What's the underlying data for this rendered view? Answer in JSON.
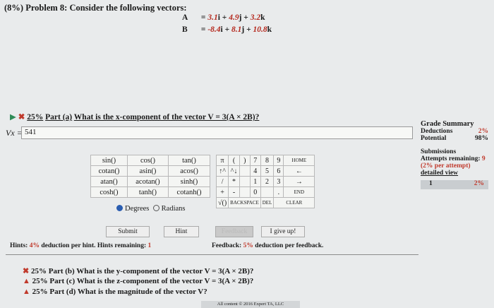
{
  "problem": {
    "title": "(8%) Problem 8: Consider the following vectors:",
    "vectors": [
      {
        "name": "A",
        "eq": "=",
        "c1": "3.1",
        "u1": "i +",
        "c2": "4.9",
        "u2": "j +",
        "c3": "3.2",
        "u3": "k"
      },
      {
        "name": "B",
        "eq": "=",
        "c1": "-8.4",
        "u1": "i +",
        "c2": "8.1",
        "u2": "j +",
        "c3": "10.8",
        "u3": "k"
      }
    ]
  },
  "part_a": {
    "arrow": "▶",
    "mark": "✖",
    "pct": "25%",
    "label": "Part (a)",
    "question": "What is the x-component of the vector V = 3(A × 2B)?",
    "answer_label": "Vx =",
    "answer_value": "541"
  },
  "keypad": {
    "functions": [
      [
        "sin()",
        "cos()",
        "tan()"
      ],
      [
        "cotan()",
        "asin()",
        "acos()"
      ],
      [
        "atan()",
        "acotan()",
        "sinh()"
      ],
      [
        "cosh()",
        "tanh()",
        "cotanh()"
      ]
    ],
    "keys": [
      [
        "π",
        "(",
        ")",
        "7",
        "8",
        "9",
        "HOME"
      ],
      [
        "↑^",
        "^↓",
        "",
        "4",
        "5",
        "6",
        "←"
      ],
      [
        "/",
        "*",
        "",
        "1",
        "2",
        "3",
        "→"
      ],
      [
        "+",
        "-",
        "",
        "0",
        "",
        ".",
        "END"
      ],
      [
        "√()",
        "BACKSPACE",
        "",
        "DEL",
        "",
        "CLEAR",
        ""
      ]
    ],
    "degrees": "Degrees",
    "radians": "Radians"
  },
  "buttons": {
    "submit": "Submit",
    "hint": "Hint",
    "feedback": "Feedback",
    "give_up": "I give up!"
  },
  "hints": {
    "prefix": "Hints:",
    "pct": "4%",
    "text": "deduction per hint. Hints remaining:",
    "remaining": "1"
  },
  "feedback": {
    "prefix": "Feedback:",
    "pct": "5%",
    "text": "deduction per feedback."
  },
  "parts": [
    {
      "icon": "✖",
      "pct": "25%",
      "label": "Part (b)",
      "question": "What is the y-component of the vector V = 3(A × 2B)?"
    },
    {
      "icon": "▲",
      "pct": "25%",
      "label": "Part (c)",
      "question": "What is the z-component of the vector V = 3(A × 2B)?"
    },
    {
      "icon": "▲",
      "pct": "25%",
      "label": "Part (d)",
      "question": "What is the magnitude of the vector V?"
    }
  ],
  "grade": {
    "title": "Grade Summary",
    "deductions_label": "Deductions",
    "deductions_value": "2%",
    "potential_label": "Potential",
    "potential_value": "98%",
    "submissions_label": "Submissions",
    "attempts_label": "Attempts remaining:",
    "attempts_value": "9",
    "per_attempt": "(2% per attempt)",
    "detailed_view": "detailed view",
    "row_index": "1",
    "row_value": "2%"
  },
  "footer": "All content © 2016 Expert TA, LLC"
}
